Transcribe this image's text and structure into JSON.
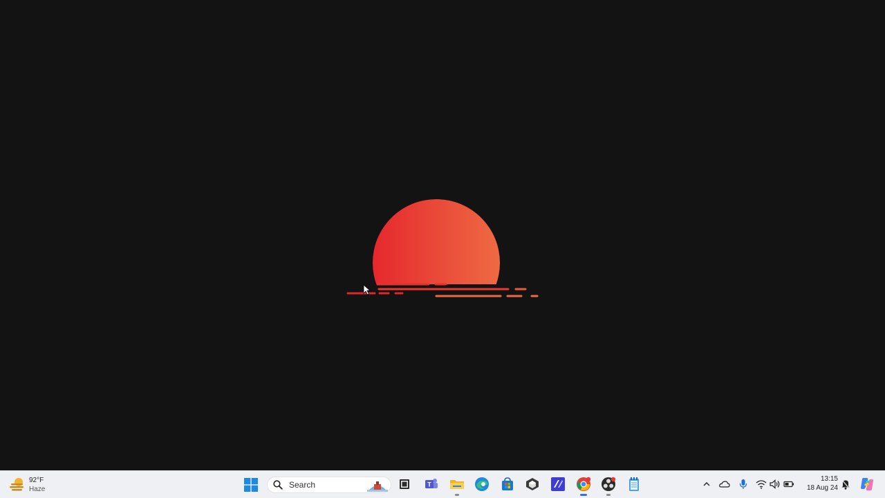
{
  "desktop": {
    "wallpaper": {
      "background_color": "#131313",
      "sun_color_left": "#e5282d",
      "sun_color_right": "#ee6a43"
    }
  },
  "taskbar": {
    "background_color": "#eef0f3",
    "weather": {
      "temperature": "92°F",
      "condition": "Haze",
      "icon": "haze-weather-icon"
    },
    "start_icon": "windows-start-icon",
    "search": {
      "placeholder": "Search"
    },
    "pinned_apps": [
      {
        "name": "task-view",
        "icon": "task-view-icon"
      },
      {
        "name": "teams",
        "icon": "teams-icon"
      },
      {
        "name": "file-explorer",
        "icon": "folder-icon"
      },
      {
        "name": "edge",
        "icon": "edge-icon"
      },
      {
        "name": "microsoft-store",
        "icon": "store-icon"
      },
      {
        "name": "app-3d",
        "icon": "cube-icon"
      },
      {
        "name": "visual-studio",
        "icon": "visual-studio-icon"
      },
      {
        "name": "chrome",
        "icon": "chrome-icon"
      },
      {
        "name": "obs",
        "icon": "obs-icon"
      },
      {
        "name": "notepad",
        "icon": "notepad-icon"
      }
    ],
    "tray": {
      "icons": [
        "chevron-up-icon",
        "onedrive-icon",
        "microphone-icon",
        "wifi-icon",
        "volume-icon",
        "battery-icon",
        "notification-bell-icon",
        "copilot-icon"
      ],
      "time": "13:15",
      "date": "18 Aug 24"
    }
  }
}
